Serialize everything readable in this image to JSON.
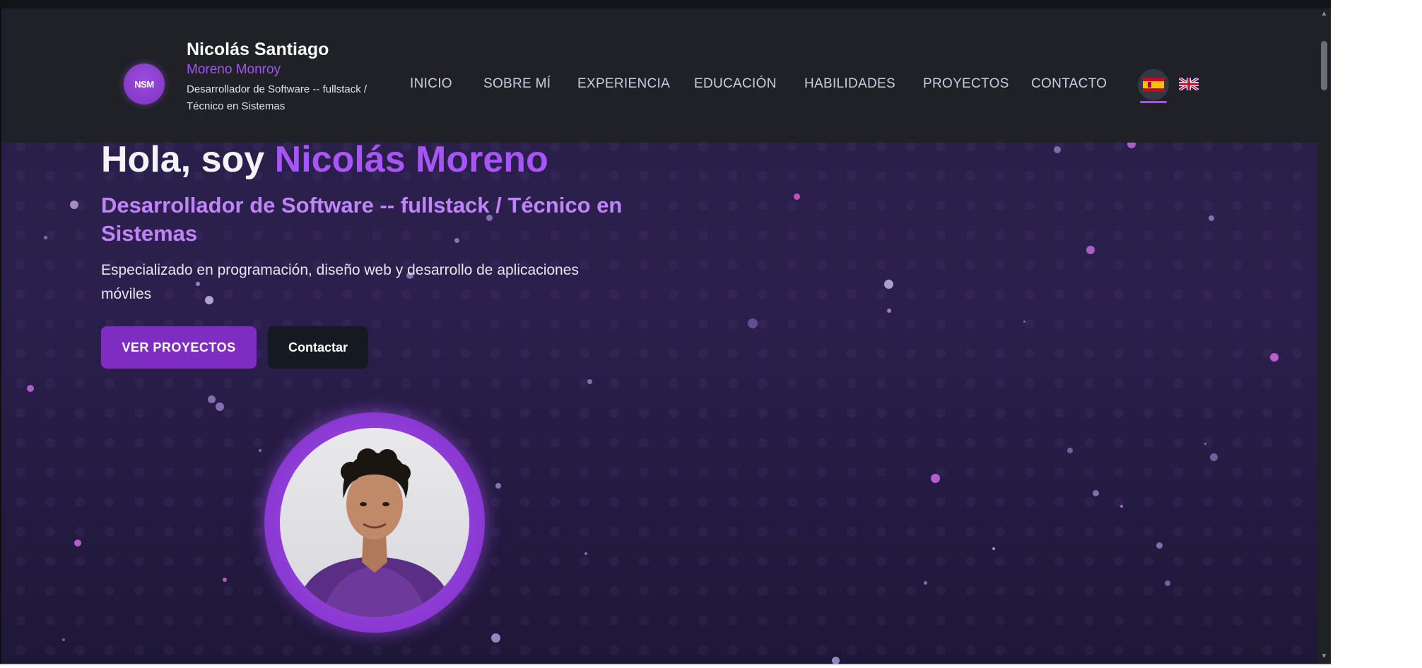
{
  "nav": {
    "logo_text": "NSM",
    "name": "Nicolás Santiago",
    "last_name": "Moreno Monroy",
    "role": "Desarrollador de Software -- fullstack / Técnico en Sistemas",
    "items": [
      {
        "label": "INICIO"
      },
      {
        "label": "SOBRE MÍ"
      },
      {
        "label": "EXPERIENCIA"
      },
      {
        "label": "EDUCACIÓN"
      },
      {
        "label": "HABILIDADES"
      },
      {
        "label": "PROYECTOS"
      },
      {
        "label": "CONTACTO"
      }
    ],
    "languages": {
      "active": "es-flag-icon",
      "other": "uk-flag-icon"
    }
  },
  "hero": {
    "greeting": "Hola, soy ",
    "name": "Nicolás Moreno",
    "role": "Desarrollador de Software -- fullstack / Técnico en Sistemas",
    "description": "Especializado en programación, diseño web y desarrollo de aplicaciones móviles",
    "primary_button": "VER PROYECTOS",
    "secondary_button": "Contactar"
  },
  "colors": {
    "accent": "#a855f7",
    "button_primary": "#7e2cc2",
    "nav_bg": "#1f2227",
    "hero_bg": "#2a1f49"
  }
}
